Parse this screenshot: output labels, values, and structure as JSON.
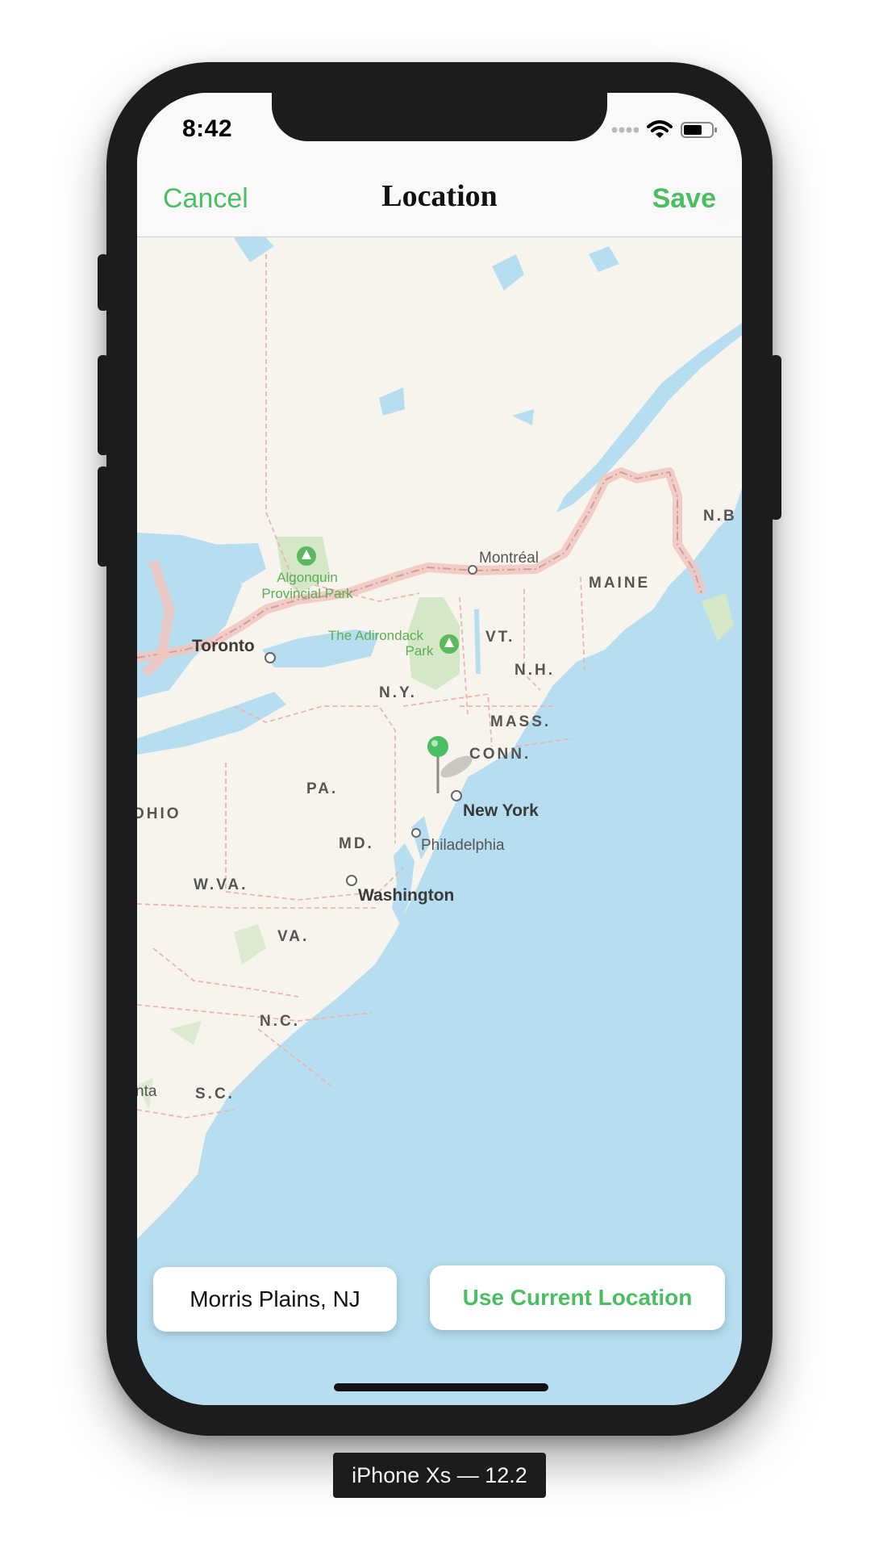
{
  "status_bar": {
    "time": "8:42",
    "icons": [
      "signal-dots-icon",
      "wifi-icon",
      "battery-icon"
    ]
  },
  "navbar": {
    "cancel_label": "Cancel",
    "title": "Location",
    "save_label": "Save"
  },
  "map": {
    "labels": {
      "algonquin_1": "Algonquin",
      "algonquin_2": "Provincial Park",
      "montreal": "Montréal",
      "maine": "MAINE",
      "nb": "N.B",
      "toronto": "Toronto",
      "adirondack_1": "The Adirondack",
      "adirondack_2": "Park",
      "vt": "VT.",
      "nh": "N.H.",
      "ny": "N.Y.",
      "mass": "MASS.",
      "conn": "CONN.",
      "pa": "PA.",
      "new_york": "New York",
      "ohio": "OHIO",
      "md": "MD.",
      "philadelphia": "Philadelphia",
      "wva": "W.VA.",
      "washington": "Washington",
      "va": "VA.",
      "nc": "N.C.",
      "sc": "S.C.",
      "nta": "nta"
    }
  },
  "buttons": {
    "selected_location": "Morris Plains, NJ",
    "use_current_location": "Use Current Location"
  },
  "device_label": "iPhone Xs — 12.2",
  "colors": {
    "accent": "#4cbe62",
    "water": "#b6def0",
    "land": "#f7f4ee",
    "park": "#d4e8c8",
    "border_line": "#e9b5ad"
  }
}
